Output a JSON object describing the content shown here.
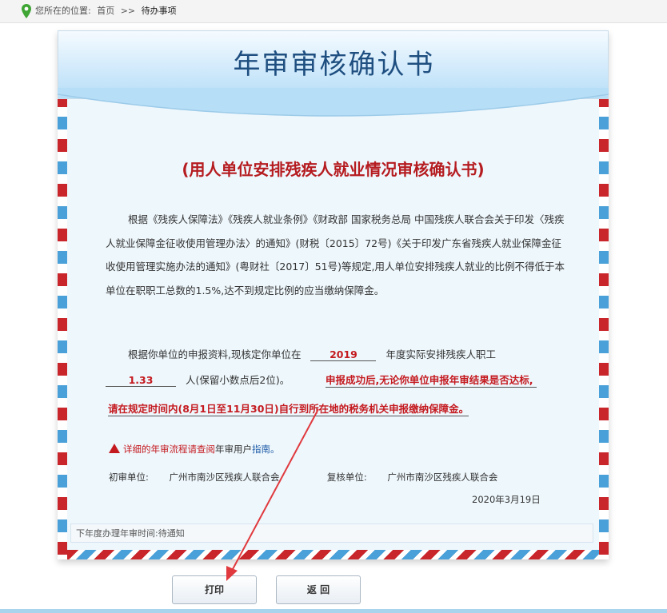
{
  "breadcrumb": {
    "prefix": "您所在的位置:",
    "home": "首页",
    "sep": ">>",
    "current": "待办事项"
  },
  "header": {
    "title": "年审审核确认书"
  },
  "doc": {
    "subtitle": "(用人单位安排残疾人就业情况审核确认书)",
    "paragraph": "根据《残疾人保障法》《残疾人就业条例》《财政部 国家税务总局 中国残疾人联合会关于印发〈残疾人就业保障金征收使用管理办法〉的通知》(财税〔2015〕72号)《关于印发广东省残疾人就业保障金征收使用管理实施办法的通知》(粤财社〔2017〕51号)等规定,用人单位安排残疾人就业的比例不得低于本单位在职职工总数的1.5%,达不到规定比例的应当缴纳保障金。",
    "line1_pre": "根据你单位的申报资料,现核定你单位在",
    "year": "2019",
    "line1_post": "年度实际安排残疾人职工",
    "count": "1.33",
    "line2_post": "人(保留小数点后2位)。",
    "notice1": "申报成功后,无论你单位申报年审结果是否达标,",
    "notice2": "请在规定时间内(8月1日至11月30日)自行到所在地的税务机关申报缴纳保障金。",
    "warn_a": "详细的",
    "warn_b": "年审流程请查阅",
    "warn_c": "年审用户",
    "warn_d": "指南。",
    "first_label": "初审单位:",
    "first_value": "广州市南沙区残疾人联合会",
    "review_label": "复核单位:",
    "review_value": "广州市南沙区残疾人联合会",
    "date": "2020年3月19日",
    "next_review": "下年度办理年审时间:待通知"
  },
  "buttons": {
    "print": "打印",
    "back": "返 回"
  },
  "colors": {
    "accent_red": "#c41a1f",
    "title_blue": "#1f4f80",
    "stripe_blue": "#4aa0d8"
  }
}
